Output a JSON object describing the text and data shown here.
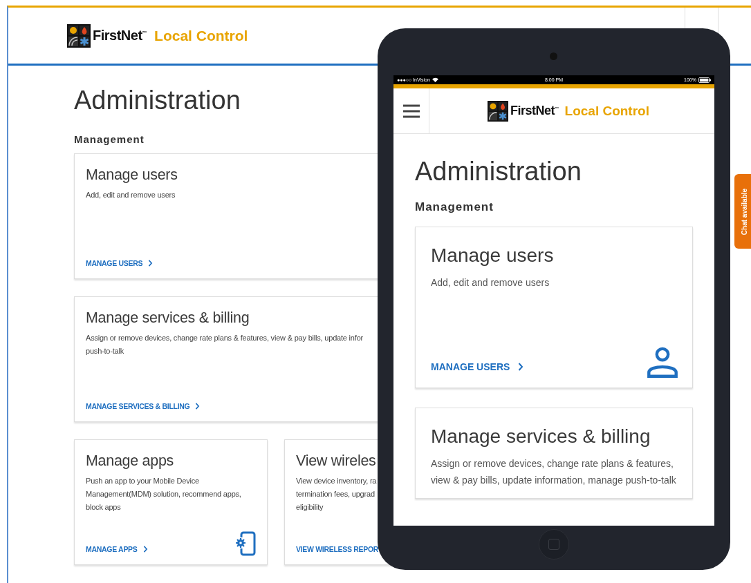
{
  "desktop": {
    "brand": "FirstNet$^{™}$",
    "product": "Local Control",
    "title": "Administration",
    "section": "Management",
    "cards": [
      {
        "kind": "users",
        "title": "Manage users",
        "description": "Add, edit and remove users",
        "link": "MANAGE USERS"
      },
      {
        "kind": "services",
        "title": "Manage services & billing",
        "description": "Assign or remove devices, change rate plans & features, view & pay bills, update infor\npush-to-talk",
        "link": "MANAGE SERVICES & BILLING"
      },
      {
        "kind": "apps",
        "title": "Manage apps",
        "description": "Push an app to your Mobile Device\nManagement(MDM) solution, recommend apps,\nblock apps",
        "link": "MANAGE APPS"
      },
      {
        "kind": "reports",
        "title": "View wireles",
        "description": "View device inventory, ra\ntermination fees, upgrad\neligibility",
        "link": "VIEW WIRELESS REPOR"
      }
    ]
  },
  "chat": {
    "label": "Chat available"
  },
  "tablet": {
    "status": {
      "carrier": "●●●○○ InVision",
      "time": "8:00 PM",
      "battery": "100%"
    },
    "brand": "FirstNet$^{™}$",
    "product": "Local Control",
    "title": "Administration",
    "section": "Management",
    "cards": [
      {
        "kind": "users",
        "title": "Manage users",
        "description": "Add, edit and remove users",
        "link": "MANAGE USERS"
      },
      {
        "kind": "services",
        "title": "Manage services & billing",
        "description": "Assign or remove devices, change rate plans & features, view & pay bills, update information, manage push-to-talk"
      }
    ]
  }
}
